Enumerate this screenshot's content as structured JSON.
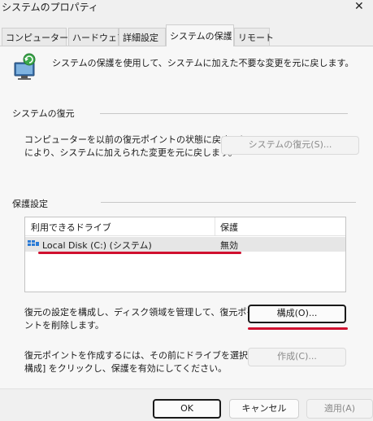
{
  "window": {
    "title": "システムのプロパティ"
  },
  "tabs": [
    {
      "label": "コンピューター名"
    },
    {
      "label": "ハードウェア"
    },
    {
      "label": "詳細設定"
    },
    {
      "label": "システムの保護"
    },
    {
      "label": "リモート"
    }
  ],
  "active_tab": "システムの保護",
  "intro_text": "システムの保護を使用して、システムに加えた不要な変更を元に戻します。",
  "restore_section": {
    "heading": "システムの復元",
    "description_line1": "コンピューターを以前の復元ポイントの状態に戻すこと",
    "description_line2": "により、システムに加えられた変更を元に戻します。",
    "button_label": "システムの復元(S)..."
  },
  "protection_section": {
    "heading": "保護設定",
    "columns": {
      "drive": "利用できるドライブ",
      "protection": "保護"
    },
    "rows": [
      {
        "drive": "Local Disk (C:) (システム)",
        "protection": "無効"
      }
    ],
    "configure_text_line1": "復元の設定を構成し、ディスク領域を管理して、復元ポイ",
    "configure_text_line2": "ントを削除します。",
    "configure_button": "構成(O)...",
    "create_text_line1": "復元ポイントを作成するには、その前にドライブを選択して [",
    "create_text_line2": "構成] をクリックし、保護を有効にしてください。",
    "create_button": "作成(C)..."
  },
  "footer": {
    "ok": "OK",
    "cancel": "キャンセル",
    "apply": "適用(A)"
  },
  "colors": {
    "highlight_red": "#d0102f"
  }
}
